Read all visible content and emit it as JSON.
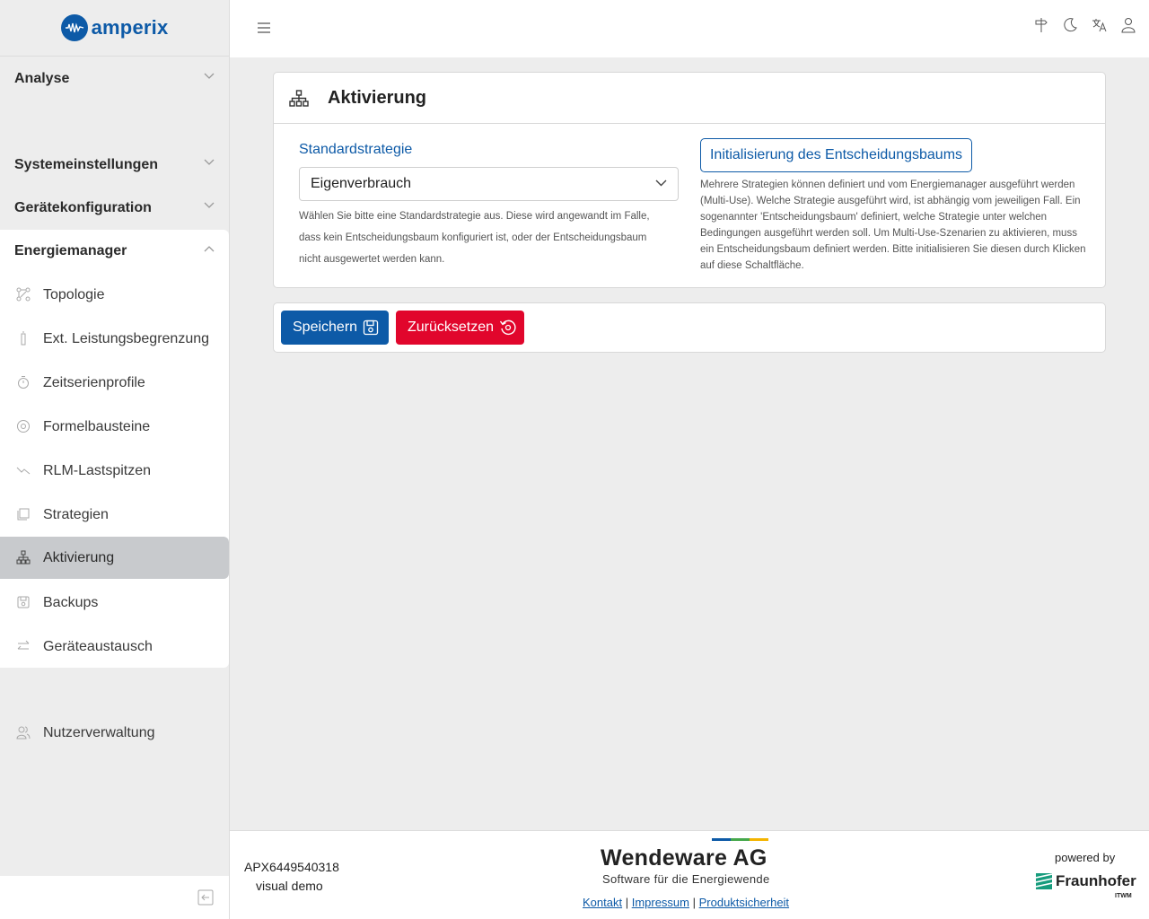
{
  "app": {
    "logo_text": "amperix"
  },
  "sidebar": {
    "sections": [
      {
        "label": "Analyse"
      },
      {
        "label": "Systemeinstellungen"
      },
      {
        "label": "Gerätekonfiguration"
      },
      {
        "label": "Energiemanager"
      }
    ],
    "items": [
      {
        "label": "Topologie",
        "icon": "topology-icon"
      },
      {
        "label": "Ext. Leistungsbegrenzung",
        "icon": "battery-icon"
      },
      {
        "label": "Zeitserienprofile",
        "icon": "timer-icon"
      },
      {
        "label": "Formelbausteine",
        "icon": "at-icon"
      },
      {
        "label": "RLM-Lastspitzen",
        "icon": "trend-icon"
      },
      {
        "label": "Strategien",
        "icon": "stack-icon"
      },
      {
        "label": "Aktivierung",
        "icon": "hierarchy-icon",
        "active": true
      },
      {
        "label": "Backups",
        "icon": "save-icon"
      },
      {
        "label": "Geräteaustausch",
        "icon": "swap-icon"
      }
    ],
    "user_item": {
      "label": "Nutzerverwaltung",
      "icon": "users-icon"
    }
  },
  "topbar": {
    "icons": [
      "signpost-icon",
      "moon-icon",
      "language-icon",
      "user-icon"
    ]
  },
  "page": {
    "title": "Aktivierung",
    "field_label": "Standardstrategie",
    "select_value": "Eigenverbrauch",
    "help_left": "Wählen Sie bitte eine Standardstrategie aus. Diese wird angewandt im Falle, dass kein Entscheidungsbaum konfiguriert ist, oder der Entscheidungsbaum nicht ausgewertet werden kann.",
    "init_button": "Initialisierung des Entscheidungsbaums",
    "help_right": "Mehrere Strategien können definiert und vom Energiemanager ausgeführt werden (Multi-Use). Welche Strategie ausgeführt wird, ist abhängig vom jeweiligen Fall. Ein sogenannter 'Entscheidungsbaum' definiert, welche Strategie unter welchen Bedingungen ausgeführt werden soll. Um Multi-Use-Szenarien zu aktivieren, muss ein Entscheidungsbaum definiert werden. Bitte initialisieren Sie diesen durch Klicken auf diese Schaltfläche."
  },
  "actions": {
    "save": "Speichern",
    "reset": "Zurücksetzen"
  },
  "footer": {
    "device_id": "APX6449540318",
    "mode": "visual demo",
    "company": "Wendeware AG",
    "tagline": "Software für die Energiewende",
    "links": [
      "Kontakt",
      "Impressum",
      "Produktsicherheit"
    ],
    "powered_by": "powered by",
    "partner": "Fraunhofer",
    "partner_sub": "ITWM"
  },
  "colors": {
    "primary": "#0d5aa7",
    "danger": "#e1062c",
    "active_bg": "#c8cacd"
  }
}
